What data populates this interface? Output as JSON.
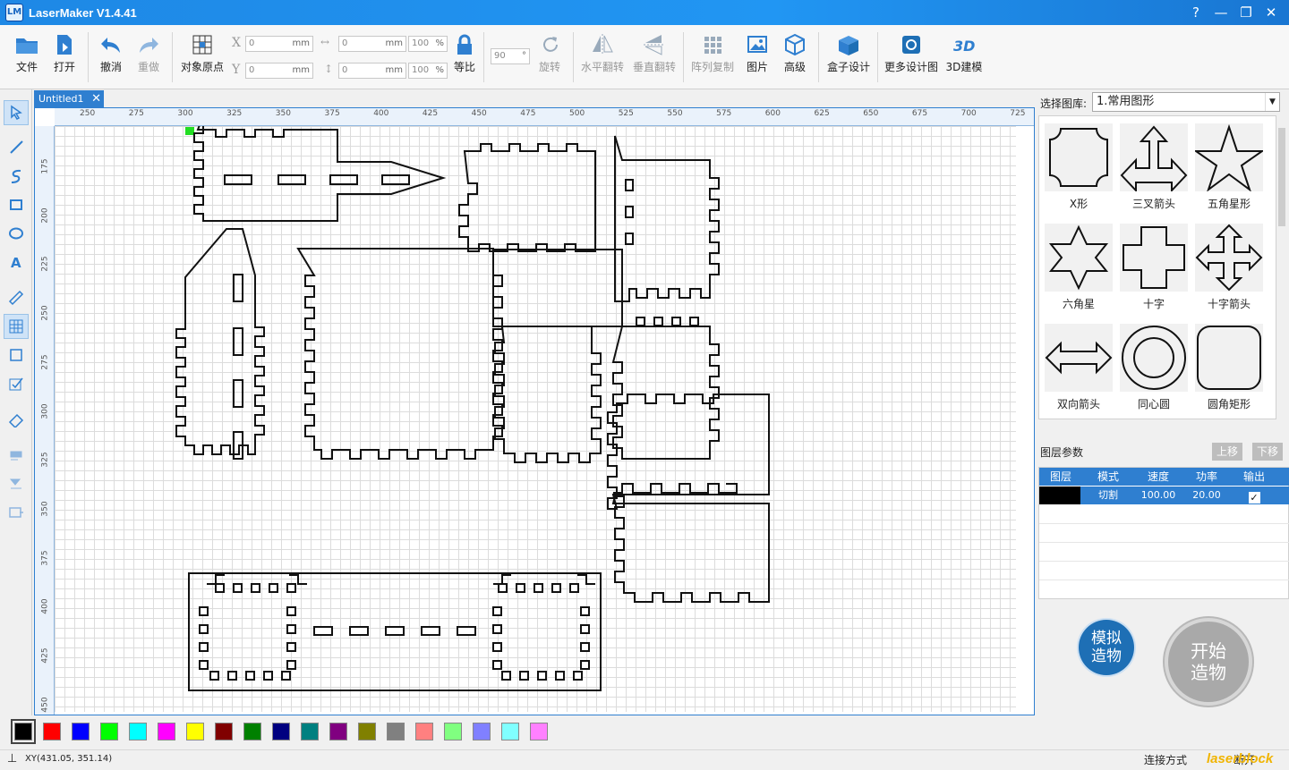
{
  "app": {
    "title": "LaserMaker V1.4.41",
    "logo_text": "LM"
  },
  "window_controls": {
    "help": "?",
    "minimize": "—",
    "restore": "❐",
    "close": "✕"
  },
  "toolbar": {
    "file": "文件",
    "open": "打开",
    "undo": "撤消",
    "redo": "重做",
    "origin": "对象原点",
    "x_label": "X",
    "y_label": "Y",
    "x_value": "0",
    "y_value": "0",
    "w_value": "0",
    "h_value": "0",
    "unit": "mm",
    "w_pct": "100",
    "h_pct": "100",
    "pct": "%",
    "ratio": "等比",
    "rotate_value": "90",
    "rotate_unit": "°",
    "rotate": "旋转",
    "flip_h": "水平翻转",
    "flip_v": "垂直翻转",
    "array": "阵列复制",
    "image": "图片",
    "advanced": "高级",
    "box_design": "盒子设计",
    "more_designs": "更多设计图",
    "model3d": "3D建模"
  },
  "tab": {
    "name": "Untitled1",
    "close": "✕"
  },
  "ruler_top": [
    "250",
    "275",
    "300",
    "325",
    "350",
    "375",
    "400",
    "425",
    "450",
    "475",
    "500",
    "525",
    "550",
    "575",
    "600",
    "625",
    "650",
    "675",
    "700",
    "725"
  ],
  "ruler_left": [
    "175",
    "200",
    "225",
    "250",
    "275",
    "300",
    "325",
    "350",
    "375",
    "400",
    "425",
    "450"
  ],
  "library": {
    "label": "选择图库:",
    "selected": "1.常用图形",
    "shapes": [
      "X形",
      "三叉箭头",
      "五角星形",
      "六角星",
      "十字",
      "十字箭头",
      "双向箭头",
      "同心圆",
      "圆角矩形"
    ]
  },
  "layers": {
    "title": "图层参数",
    "up": "上移",
    "down": "下移",
    "headers": [
      "图层",
      "模式",
      "速度",
      "功率",
      "输出"
    ],
    "rows": [
      {
        "color": "#000000",
        "mode": "切割",
        "speed": "100.00",
        "power": "20.00",
        "output": "✓"
      }
    ]
  },
  "sim_button": "模拟\n造物",
  "start_button": "开始\n造物",
  "palette": [
    "#000000",
    "#ff0000",
    "#0000ff",
    "#00ff00",
    "#00ffff",
    "#ff00ff",
    "#ffff00",
    "#800000",
    "#008000",
    "#000080",
    "#008080",
    "#800080",
    "#808000",
    "#808080",
    "#ff8080",
    "#80ff80",
    "#8080ff",
    "#80ffff",
    "#ff80ff"
  ],
  "status": {
    "coord": "XY(431.05, 351.14)",
    "connection": "连接方式",
    "disconnected": "断开",
    "watermark": "laserblock"
  }
}
